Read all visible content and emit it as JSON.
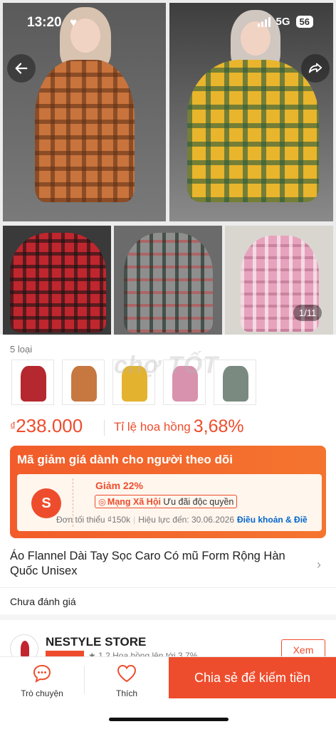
{
  "status_bar": {
    "time": "13:20",
    "network": "5G",
    "battery": "56"
  },
  "gallery": {
    "counter": "1/11"
  },
  "variants": {
    "count_label": "5 loại",
    "watermark": "chợ TỐT"
  },
  "price": {
    "currency": "₫",
    "amount": "238.000",
    "commission_label": "Tỉ lệ hoa hồng",
    "commission_rate": "3,68%"
  },
  "voucher": {
    "title": "Mã giảm giá dành cho người theo dõi",
    "discount": "Giảm 22%",
    "badge_brand": "Mạng Xã Hội",
    "badge_exclusive": "Ưu đãi độc quyền",
    "min_order": "Đơn tối thiểu ₫150k",
    "validity": "Hiệu lực đến: 30.06.2026",
    "terms": "Điều khoản & Điề"
  },
  "product": {
    "title": "Áo Flannel Dài Tay Sọc Caro Có mũ Form Rộng Hàn Quốc Unisex",
    "rating": "Chưa đánh giá"
  },
  "shop": {
    "name": "NESTYLE STORE",
    "sub_text": "★ 1.2   Hoa hồng lên tới 3,7%",
    "view_label": "Xem"
  },
  "action_bar": {
    "chat_label": "Trò chuyện",
    "like_label": "Thích",
    "share_earn_label": "Chia sẻ để kiếm tiền"
  },
  "colors": {
    "accent": "#ee4d2d",
    "link": "#0066cc"
  }
}
